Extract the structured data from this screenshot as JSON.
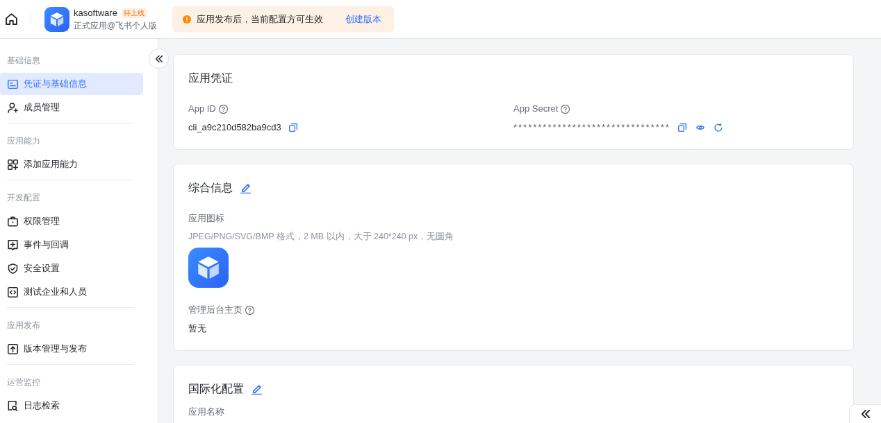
{
  "header": {
    "app": {
      "name": "kasoftware",
      "status_badge": "待上线",
      "subtitle": "正式应用@飞书个人版"
    },
    "notice": {
      "message": "应用发布后，当前配置方可生效",
      "link": "创建版本"
    }
  },
  "sidebar": {
    "groups": [
      {
        "title": "基础信息",
        "items": [
          {
            "label": "凭证与基础信息",
            "selected": true
          },
          {
            "label": "成员管理",
            "selected": false
          }
        ]
      },
      {
        "title": "应用能力",
        "items": [
          {
            "label": "添加应用能力",
            "selected": false
          }
        ]
      },
      {
        "title": "开发配置",
        "items": [
          {
            "label": "权限管理",
            "selected": false
          },
          {
            "label": "事件与回调",
            "selected": false
          },
          {
            "label": "安全设置",
            "selected": false
          },
          {
            "label": "测试企业和人员",
            "selected": false
          }
        ]
      },
      {
        "title": "应用发布",
        "items": [
          {
            "label": "版本管理与发布",
            "selected": false
          }
        ]
      },
      {
        "title": "运营监控",
        "items": [
          {
            "label": "日志检索",
            "selected": false
          }
        ]
      }
    ]
  },
  "cards": [
    {
      "kind": "columns",
      "title": "应用凭证",
      "editable": false,
      "fields": [
        {
          "kind": "text",
          "label": "App ID",
          "help": true,
          "value": "cli_a9c210d582ba9cd3",
          "masked": false,
          "copyable": true,
          "revealable": false,
          "resettable": false
        },
        {
          "kind": "text",
          "label": "App Secret",
          "help": true,
          "value": "********************************",
          "masked": true,
          "copyable": true,
          "revealable": true,
          "resettable": true
        }
      ]
    },
    {
      "kind": "stack",
      "title": "综合信息",
      "editable": true,
      "fields": [
        {
          "kind": "image",
          "label": "应用图标",
          "help": false,
          "hint": "JPEG/PNG/SVG/BMP 格式，2 MB 以内，大于 240*240 px，无圆角"
        },
        {
          "kind": "text",
          "label": "管理后台主页",
          "help": true,
          "value": "暂无",
          "masked": false,
          "copyable": false,
          "revealable": false,
          "resettable": false
        }
      ]
    },
    {
      "kind": "list",
      "title": "国际化配置",
      "editable": true,
      "fields": [
        {
          "kind": "text",
          "label": "应用名称",
          "help": false
        }
      ]
    }
  ]
}
